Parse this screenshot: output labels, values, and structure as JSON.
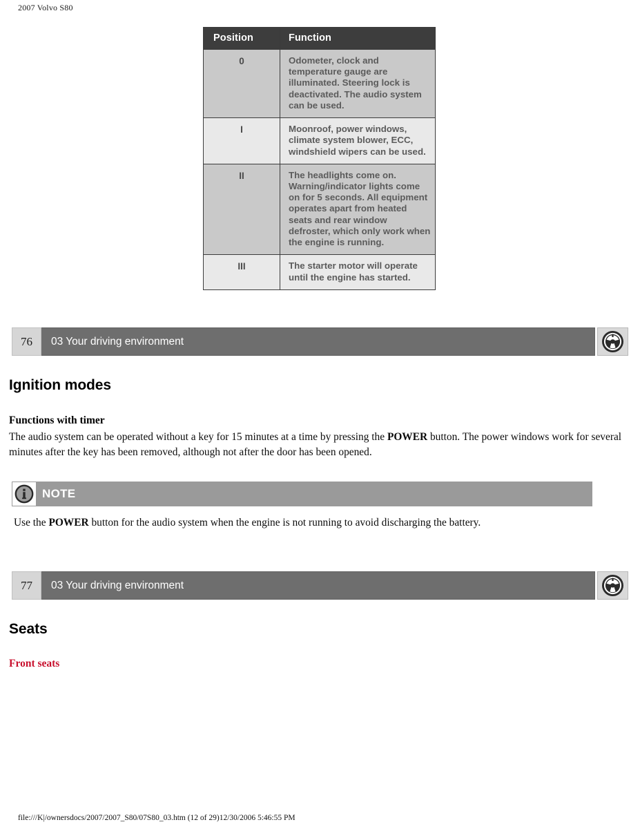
{
  "document": {
    "running_header": "2007 Volvo S80",
    "print_footer": "file:///K|/ownersdocs/2007/2007_S80/07S80_03.htm (12 of 29)12/30/2006 5:46:55 PM"
  },
  "ignition_table": {
    "headers": {
      "position": "Position",
      "function": "Function"
    },
    "rows": [
      {
        "position": "0",
        "function": "Odometer, clock and temperature gauge are illuminated. Steering lock is deactivated. The audio system can be used."
      },
      {
        "position": "I",
        "function": "Moonroof, power windows, climate system blower, ECC, windshield wipers can be used."
      },
      {
        "position": "II",
        "function": "The headlights come on. Warning/indicator lights come on for 5 seconds. All equipment operates apart from heated seats and rear window defroster, which only work when the engine is running."
      },
      {
        "position": "III",
        "function": "The starter motor will operate until the engine has started."
      }
    ]
  },
  "page_bars": [
    {
      "number": "76",
      "chapter": "03 Your driving environment"
    },
    {
      "number": "77",
      "chapter": "03 Your driving environment"
    }
  ],
  "sections": {
    "ignition_modes": {
      "title": "Ignition modes",
      "subtitle": "Functions with timer",
      "paragraph_before_bold": "The audio system can be operated without a key for 15 minutes at a time by pressing the ",
      "paragraph_bold": "POWER",
      "paragraph_after_bold": " button. The power windows work for several minutes after the key has been removed, although not after the door has been opened."
    },
    "note": {
      "label": "NOTE",
      "text_before_bold": "Use the ",
      "text_bold": "POWER",
      "text_after_bold": " button for the audio system when the engine is not running to avoid discharging the battery."
    },
    "seats": {
      "title": "Seats",
      "subtitle": "Front seats"
    }
  },
  "colors": {
    "accent_red": "#c8102e",
    "bar_gray": "#6e6e6e",
    "note_gray": "#9a9a9a",
    "table_header_gray": "#3d3d3d"
  }
}
